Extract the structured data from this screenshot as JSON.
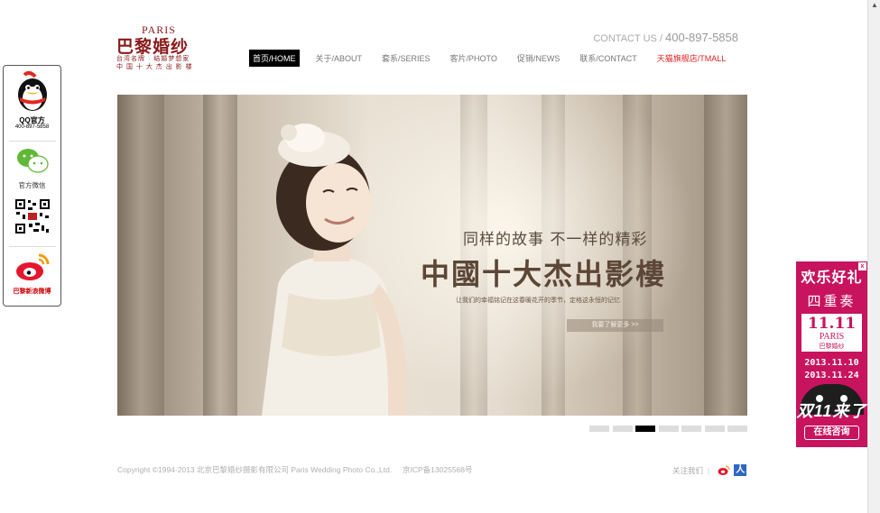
{
  "logo": {
    "en": "PARIS",
    "cn": "巴黎婚纱",
    "tagline1": "台湾名牌 · 结婚梦想家",
    "tagline2": "中 国 十 大 杰 出 影 楼"
  },
  "header": {
    "contact_label": "CONTACT US",
    "contact_sep": " / ",
    "phone": "400-897-5858"
  },
  "nav": [
    {
      "label": "首页/HOME"
    },
    {
      "label": "关于/ABOUT"
    },
    {
      "label": "套系/SERIES"
    },
    {
      "label": "客片/PHOTO"
    },
    {
      "label": "促销/NEWS"
    },
    {
      "label": "联系/CONTACT"
    },
    {
      "label": "天猫旗舰店/TMALL"
    }
  ],
  "hero": {
    "slogan_line1": "同样的故事  不一样的精彩",
    "slogan_line2": "中國十大杰出影樓",
    "slogan_line3": "让我们的幸福铭记在这春暖花开的季节，定格这永恒的记忆",
    "button": "我要了解更多 >>"
  },
  "slider": {
    "count": 7,
    "active": 3
  },
  "footer": {
    "copyright": "Copyright ©1994-2013 北京巴黎婚纱摄影有限公司  Paris Wedding Photo Co.,Ltd.",
    "icp": "京ICP备13025568号",
    "follow": "关注我们",
    "separator": "|",
    "renren": "人"
  },
  "leftbar": {
    "qq_label": "QQ官方",
    "qq_number": "400-897-5858",
    "wechat_label": "官方微信",
    "weibo_label": "巴黎新浪微博"
  },
  "ad": {
    "line1": "欢乐好礼",
    "line2": "四重奏",
    "big": "11.11",
    "paris": "PARIS",
    "brand": "巴黎婚纱",
    "date1": "2013.11.10",
    "date2": "2013.11.24",
    "slogan": "双11来了",
    "button": "在线咨询",
    "close": "x"
  },
  "colors": {
    "brand": "#8a1a1a",
    "ad": "#c8135e",
    "tmall": "#dd2222"
  }
}
